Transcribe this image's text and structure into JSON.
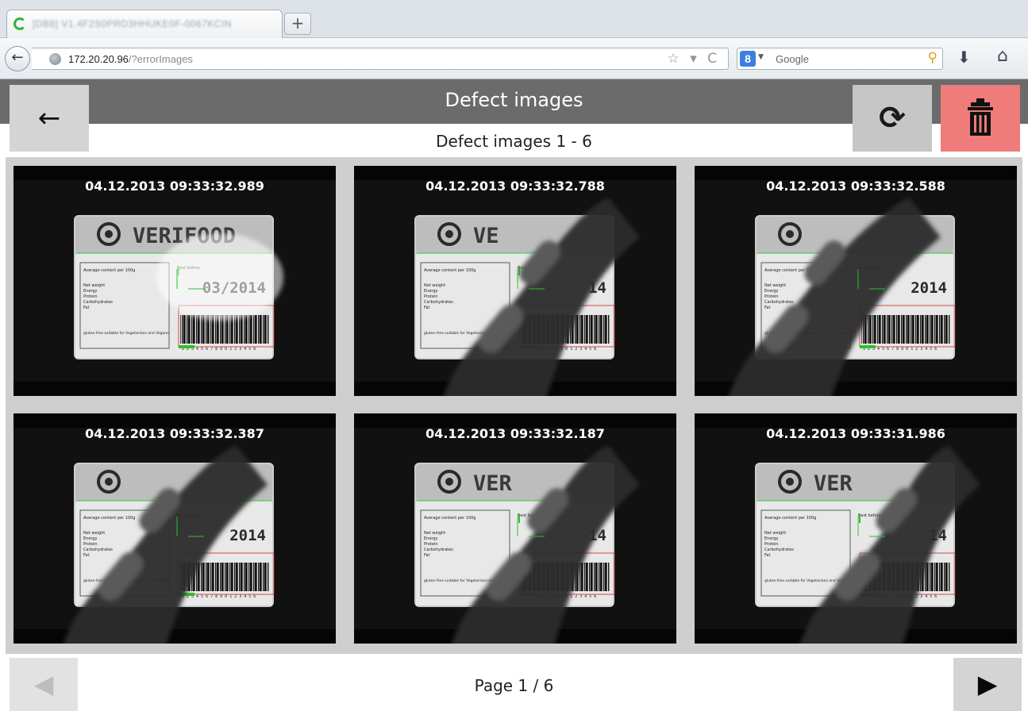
{
  "browser": {
    "tab_title": "[DB8] V1.4F2S0PRD3HHUKE0F-0067KCIN",
    "new_tab_label": "+",
    "url_host": "172.20.20.96",
    "url_path": "/?errorImages",
    "url_icons": "☆ ▾ C",
    "search_engine_badge": "8",
    "search_placeholder": "Google"
  },
  "app": {
    "title": "Defect images",
    "subtitle": "Defect images 1 - 6",
    "back_label": "←",
    "refresh_label": "⟳"
  },
  "gallery": {
    "images": [
      {
        "timestamp": "04.12.2013 09:33:32.989"
      },
      {
        "timestamp": "04.12.2013 09:33:32.788"
      },
      {
        "timestamp": "04.12.2013 09:33:32.588"
      },
      {
        "timestamp": "04.12.2013 09:33:32.387"
      },
      {
        "timestamp": "04.12.2013 09:33:32.187"
      },
      {
        "timestamp": "04.12.2013 09:33:31.986"
      }
    ],
    "label_brand": "VERIFOOD",
    "label_date": "03/2014",
    "label_year": "2014",
    "label_best_before": "Best before",
    "label_content_header": "Average content per 100g",
    "label_rows": [
      "Net weight",
      "Energy",
      "Protein",
      "Carbohydrates",
      "Fat"
    ],
    "label_footer": "gluten-free suitable for Vegetarians and Vegans",
    "barcode_digits": "1 2 3 4 5 6 7 8 9 0 1 2 3 4 5 6"
  },
  "pager": {
    "prev_label": "◀",
    "next_label": "▶",
    "page_text": "Page 1 / 6"
  }
}
